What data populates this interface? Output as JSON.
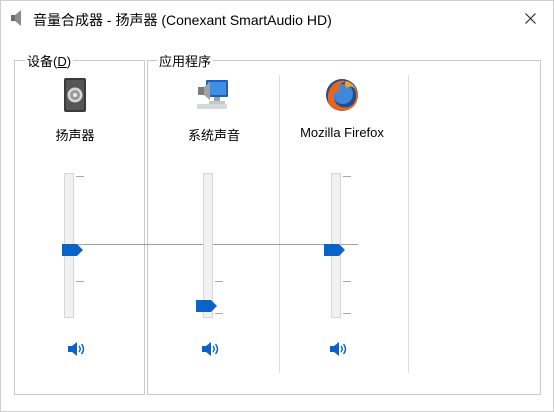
{
  "window": {
    "title": "音量合成器 - 扬声器 (Conexant SmartAudio HD)"
  },
  "devices": {
    "group_title": "设备(",
    "group_mnemonic": "D",
    "group_title_end": ")",
    "channel": {
      "label": "扬声器",
      "icon": "speaker-device-icon",
      "volume_fraction": 0.47
    }
  },
  "applications": {
    "group_title": "应用程序",
    "channels": [
      {
        "label": "系统声音",
        "icon": "system-sounds-icon",
        "volume_fraction": 0.08
      },
      {
        "label": "Mozilla Firefox",
        "icon": "firefox-icon",
        "volume_fraction": 0.47
      }
    ]
  },
  "colors": {
    "accent": "#0a63c9",
    "border": "#c9c9c9"
  }
}
